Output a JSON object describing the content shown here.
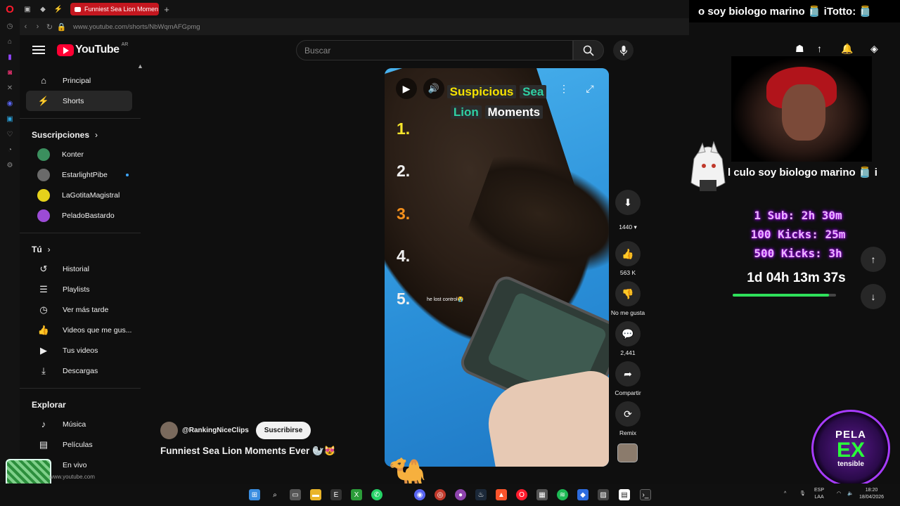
{
  "browser": {
    "tab_title": "Funniest Sea Lion Momen",
    "new_tab": "+",
    "url": "www.youtube.com/shorts/NbWqmAFGpmg",
    "hover_url": "www.youtube.com"
  },
  "youtube": {
    "logo_text": "YouTube",
    "country": "AR",
    "search_placeholder": "Buscar"
  },
  "sidebar": {
    "main": [
      {
        "label": "Principal",
        "icon": "home-icon"
      },
      {
        "label": "Shorts",
        "icon": "shorts-icon"
      }
    ],
    "subscriptions_title": "Suscripciones",
    "subscriptions": [
      {
        "label": "Konter",
        "color": "#3b8f5e"
      },
      {
        "label": "EstarlightPibe",
        "color": "#6a6a6a"
      },
      {
        "label": "LaGotitaMagistral",
        "color": "#e6d21b"
      },
      {
        "label": "PeladoBastardo",
        "color": "#9c4bd6"
      }
    ],
    "you_title": "Tú",
    "you": [
      {
        "label": "Historial",
        "icon": "history-icon"
      },
      {
        "label": "Playlists",
        "icon": "playlist-icon"
      },
      {
        "label": "Ver más tarde",
        "icon": "clock-icon"
      },
      {
        "label": "Videos que me gus...",
        "icon": "thumb-up-icon"
      },
      {
        "label": "Tus videos",
        "icon": "video-icon"
      },
      {
        "label": "Descargas",
        "icon": "download-icon"
      }
    ],
    "explore_title": "Explorar",
    "explore": [
      {
        "label": "Música",
        "icon": "music-icon"
      },
      {
        "label": "Películas",
        "icon": "film-icon"
      },
      {
        "label": "En vivo",
        "icon": "live-icon"
      }
    ]
  },
  "video": {
    "title_line1a": "Suspicious",
    "title_line1b": "Sea",
    "title_line2a": "Lion",
    "title_line2b": "Moments",
    "numbers": [
      "1.",
      "2.",
      "3.",
      "4.",
      "5."
    ],
    "caption": "he lost control😭"
  },
  "actions": {
    "speed": "1440",
    "likes": "563 K",
    "dislike": "No me gusta",
    "comments": "2,441",
    "share": "Compartir",
    "remix": "Remix"
  },
  "channel": {
    "handle": "@RankingNiceClips",
    "subscribe": "Suscribirse",
    "video_title": "Funniest Sea Lion Moments Ever 🦭😻"
  },
  "stream": {
    "ticker_top": "o soy biologo marino  🫙  iTotto: 🫙",
    "ticker_mid": "l culo soy biologo marino  🫙  i",
    "goals": [
      "1 Sub: 2h 30m",
      "100 Kicks: 25m",
      "500 Kicks: 3h"
    ],
    "timer": "1d 04h 13m 37s",
    "timer_progress": 0.93,
    "logo_top": "PELA",
    "logo_mid": "EX",
    "logo_bottom": "tensible"
  },
  "taskbar": {
    "lang1": "ESP",
    "lang2": "LAA",
    "time": "18:20",
    "date": "18/04/2026"
  }
}
